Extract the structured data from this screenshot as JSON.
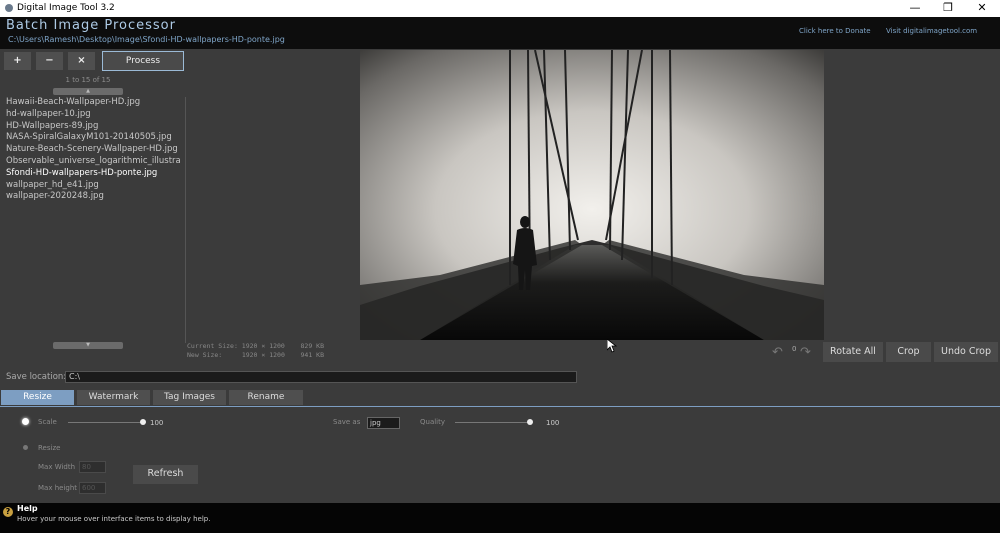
{
  "window": {
    "title": "Digital Image Tool 3.2",
    "min": "—",
    "max": "❐",
    "close": "✕"
  },
  "header": {
    "app_title": "Batch Image Processor",
    "path": "C:\\Users\\Ramesh\\Desktop\\Image\\Sfondi-HD-wallpapers-HD-ponte.jpg",
    "donate": "Click here to Donate",
    "visit": "Visit digitalimagetool.com"
  },
  "toolbar": {
    "add": "+",
    "remove": "−",
    "clear": "×",
    "process": "Process"
  },
  "files": {
    "count": "1 to 15 of 15",
    "items": [
      "Hawaii-Beach-Wallpaper-HD.jpg",
      "hd-wallpaper-10.jpg",
      "HD-Wallpapers-89.jpg",
      "NASA-SpiralGalaxyM101-20140505.jpg",
      "Nature-Beach-Scenery-Wallpaper-HD.jpg",
      "Observable_universe_logarithmic_illustra",
      "Sfondi-HD-wallpapers-HD-ponte.jpg",
      "wallpaper_hd_e41.jpg",
      "wallpaper-2020248.jpg"
    ],
    "selected_index": 6
  },
  "info": {
    "current_label": "Current Size:",
    "current_dims": "1920 × 1200",
    "current_kb": "829 KB",
    "new_label": "New Size:",
    "new_dims": "1920 × 1200",
    "new_kb": "941 KB"
  },
  "actions": {
    "rotation_count": "0",
    "rotate_all": "Rotate All",
    "crop": "Crop",
    "undo_crop": "Undo Crop"
  },
  "save": {
    "label": "Save location:",
    "value": "C:\\"
  },
  "tabs": [
    "Resize",
    "Watermark",
    "Tag Images",
    "Rename"
  ],
  "resize": {
    "scale_label": "Scale",
    "scale_value": "100",
    "scale_level": 1.0,
    "resize_label": "Resize",
    "max_width_label": "Max Width",
    "max_width": "80",
    "max_height_label": "Max height",
    "max_height": "600",
    "save_as_label": "Save as",
    "save_as": "jpg",
    "quality_label": "Quality",
    "quality_value": "100",
    "quality_level": 1.0,
    "refresh": "Refresh"
  },
  "help": {
    "icon": "?",
    "title": "Help",
    "text": "Hover your mouse over interface items to display help."
  },
  "colors": {
    "accent": "#7d9ec2",
    "header_bg": "#0d0d0d",
    "panel_bg": "#3b3b3b"
  }
}
